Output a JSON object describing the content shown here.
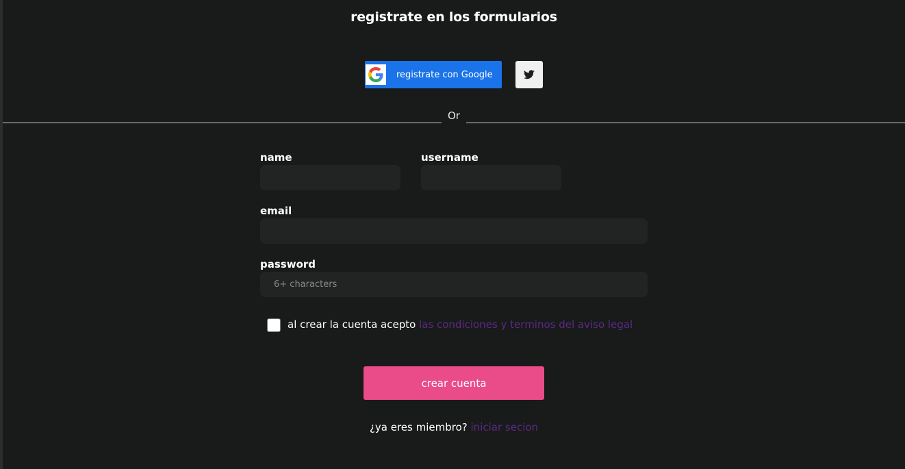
{
  "header": {
    "title": "registrate en los formularios"
  },
  "social": {
    "google_label": "registrate con Google",
    "google_icon": "google-logo-icon",
    "twitter_icon": "twitter-bird-icon"
  },
  "divider": {
    "text": "Or"
  },
  "form": {
    "name_label": "name",
    "name_value": "",
    "username_label": "username",
    "username_value": "",
    "email_label": "email",
    "email_value": "",
    "password_label": "password",
    "password_placeholder": "6+ characters",
    "terms_checked": false,
    "terms_text": "al crear la cuenta acepto",
    "terms_link": "las condiciones y terminos del aviso legal",
    "submit_label": "crear cuenta"
  },
  "footer": {
    "member_text": "¿ya eres miembro?",
    "login_link": "iniciar secion"
  },
  "colors": {
    "background": "#191a1a",
    "input_bg": "#222323",
    "google_blue": "#1a73e8",
    "submit_pink": "#ea4c89",
    "link_purple": "#5b2a86"
  }
}
